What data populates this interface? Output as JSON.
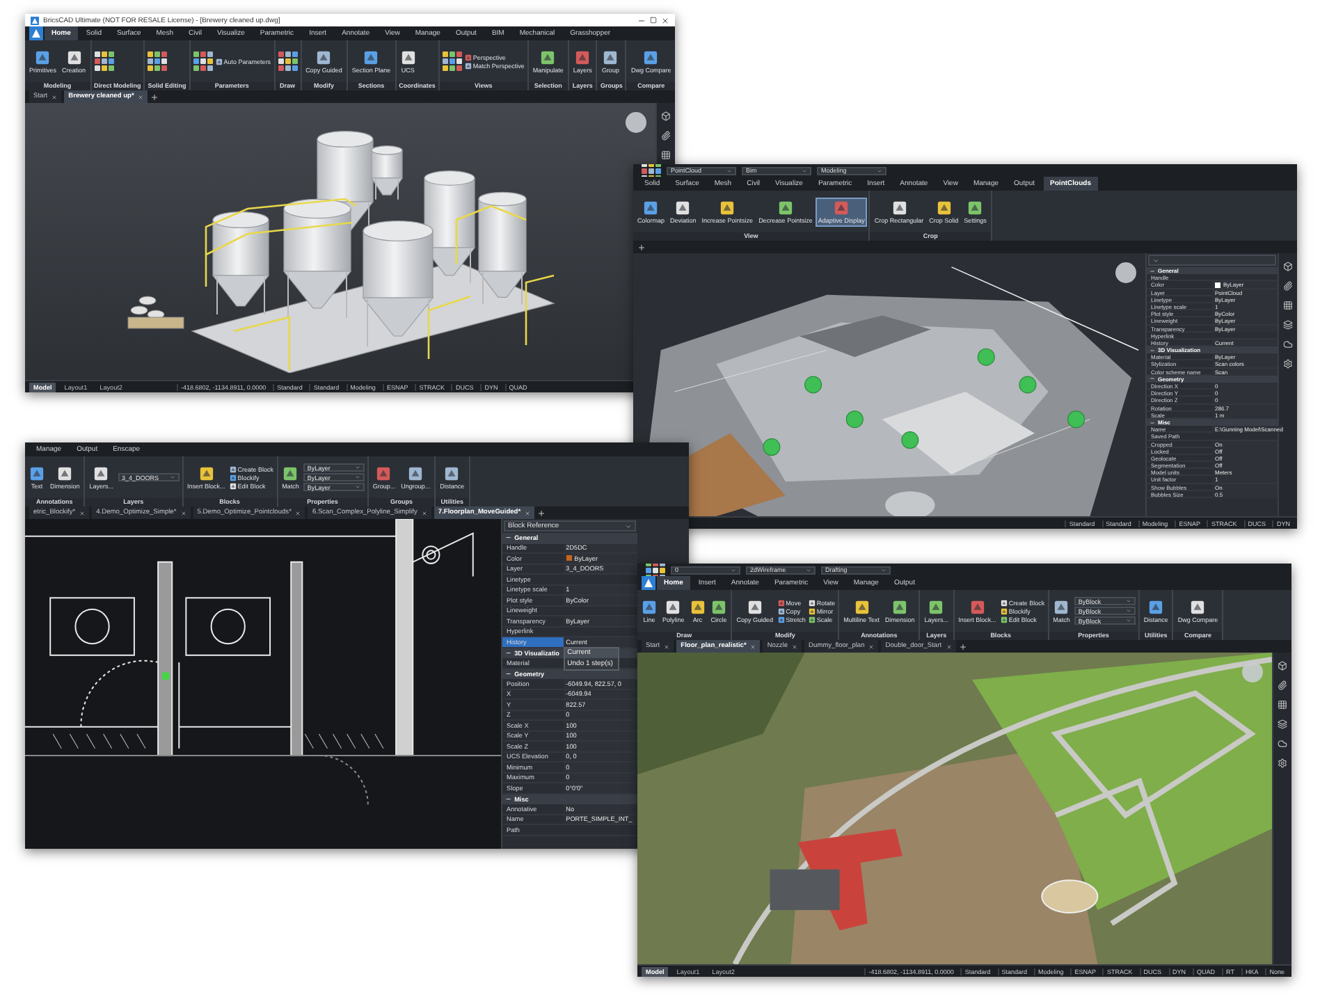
{
  "windows": [
    {
      "kind": "brewery",
      "title": "BricsCAD Ultimate (NOT FOR RESALE License) - [Brewery cleaned up.dwg]",
      "tabs": [
        {
          "label": "Home",
          "selected": true
        },
        {
          "label": "Solid",
          "selected": false
        },
        {
          "label": "Surface",
          "selected": false
        },
        {
          "label": "Mesh",
          "selected": false
        },
        {
          "label": "Civil",
          "selected": false
        },
        {
          "label": "Visualize",
          "selected": false
        },
        {
          "label": "Parametric",
          "selected": false
        },
        {
          "label": "Insert",
          "selected": false
        },
        {
          "label": "Annotate",
          "selected": false
        },
        {
          "label": "View",
          "selected": false
        },
        {
          "label": "Manage",
          "selected": false
        },
        {
          "label": "Output",
          "selected": false
        },
        {
          "label": "BIM",
          "selected": false
        },
        {
          "label": "Mechanical",
          "selected": false
        },
        {
          "label": "Grasshopper",
          "selected": false
        }
      ],
      "ribbon_panels": [
        {
          "label": "Modeling",
          "tools": [
            {
              "kind": "large",
              "label": "Primitives"
            },
            {
              "kind": "large",
              "label": "Creation"
            }
          ]
        },
        {
          "label": "Direct Modeling"
        },
        {
          "label": "Solid Editing"
        },
        {
          "label": "Parameters",
          "tools": [
            {
              "kind": "small",
              "label": "Auto Parameters"
            }
          ]
        },
        {
          "label": "Draw"
        },
        {
          "label": "Modify",
          "tools": [
            {
              "kind": "large",
              "label": "Copy Guided"
            }
          ]
        },
        {
          "label": "Sections",
          "tools": [
            {
              "kind": "large",
              "label": "Section Plane"
            }
          ]
        },
        {
          "label": "Coordinates",
          "tools": [
            {
              "kind": "large",
              "label": "UCS"
            }
          ]
        },
        {
          "label": "Views",
          "tools": [
            {
              "kind": "small",
              "label": "Perspective"
            },
            {
              "kind": "small",
              "label": "Match Perspective"
            }
          ]
        },
        {
          "label": "Selection",
          "tools": [
            {
              "kind": "large",
              "label": "Manipulate"
            }
          ]
        },
        {
          "label": "Layers",
          "tools": [
            {
              "kind": "large",
              "label": "Layers"
            }
          ]
        },
        {
          "label": "Groups",
          "tools": [
            {
              "kind": "large",
              "label": "Group"
            }
          ]
        },
        {
          "label": "Compare",
          "tools": [
            {
              "kind": "large",
              "label": "Dwg Compare"
            }
          ]
        }
      ],
      "doc_tabs": [
        {
          "label": "Start",
          "selected": false
        },
        {
          "label": "Brewery cleaned up*",
          "selected": true
        }
      ],
      "layout_tabs": [
        {
          "label": "Model",
          "selected": true
        },
        {
          "label": "Layout1",
          "selected": false
        },
        {
          "label": "Layout2",
          "selected": false
        }
      ],
      "status_items": [
        "-418.6802, -1134.8911, 0.0000",
        "Standard",
        "Standard",
        "Modeling",
        "ESNAP",
        "STRACK",
        "DUCS",
        "DYN",
        "QUAD"
      ]
    },
    {
      "kind": "pointcloud",
      "quick_fields": [
        "PointCloud",
        "Bim",
        "Modeling"
      ],
      "tabs": [
        {
          "label": "Solid",
          "selected": false
        },
        {
          "label": "Surface",
          "selected": false
        },
        {
          "label": "Mesh",
          "selected": false
        },
        {
          "label": "Civil",
          "selected": false
        },
        {
          "label": "Visualize",
          "selected": false
        },
        {
          "label": "Parametric",
          "selected": false
        },
        {
          "label": "Insert",
          "selected": false
        },
        {
          "label": "Annotate",
          "selected": false
        },
        {
          "label": "View",
          "selected": false
        },
        {
          "label": "Manage",
          "selected": false
        },
        {
          "label": "Output",
          "selected": false
        },
        {
          "label": "PointClouds",
          "selected": true
        }
      ],
      "ribbon_panels": [
        {
          "label": "View",
          "tools": [
            {
              "kind": "large",
              "label": "Colormap",
              "selected": false
            },
            {
              "kind": "large",
              "label": "Deviation",
              "selected": false
            },
            {
              "kind": "large",
              "label": "Increase Pointsize",
              "selected": false
            },
            {
              "kind": "large",
              "label": "Decrease Pointsize",
              "selected": false
            },
            {
              "kind": "large",
              "label": "Adaptive Display",
              "selected": true
            }
          ]
        },
        {
          "label": "Crop",
          "tools": [
            {
              "kind": "large",
              "label": "Crop Rectangular",
              "selected": false
            },
            {
              "kind": "large",
              "label": "Crop Solid",
              "selected": false
            },
            {
              "kind": "large",
              "label": "Settings",
              "selected": false
            }
          ]
        }
      ],
      "status_items": [
        "Standard",
        "Standard",
        "Modeling",
        "ESNAP",
        "STRACK",
        "DUCS",
        "DYN"
      ],
      "properties": {
        "sections": [
          {
            "title": "General",
            "rows": [
              {
                "label": "Handle",
                "selected": false
              },
              {
                "label": "Color",
                "value": "ByLayer",
                "color": "#ffffff",
                "selected": false
              },
              {
                "label": "Layer",
                "value": "PointCloud",
                "selected": false
              },
              {
                "label": "Linetype",
                "value": "ByLayer",
                "selected": false
              },
              {
                "label": "Linetype scale",
                "value": "1",
                "selected": false
              },
              {
                "label": "Plot style",
                "value": "ByColor",
                "selected": false
              },
              {
                "label": "Lineweight",
                "value": "ByLayer",
                "selected": false
              },
              {
                "label": "Transparency",
                "value": "ByLayer",
                "selected": false
              },
              {
                "label": "Hyperlink",
                "selected": false
              },
              {
                "label": "History",
                "value": "Current",
                "selected": false
              }
            ]
          },
          {
            "title": "3D Visualization",
            "rows": [
              {
                "label": "Material",
                "value": "ByLayer",
                "selected": false
              },
              {
                "label": "Stylization",
                "value": "Scan colors",
                "selected": false
              },
              {
                "label": "Color scheme name",
                "value": "Scan",
                "selected": false
              }
            ]
          },
          {
            "title": "Geometry",
            "rows": [
              {
                "label": "Direction X",
                "value": "0",
                "selected": false
              },
              {
                "label": "Direction Y",
                "value": "0",
                "selected": false
              },
              {
                "label": "Direction Z",
                "value": "0",
                "selected": false
              },
              {
                "label": "Rotation",
                "value": "286.7",
                "selected": false
              },
              {
                "label": "Scale",
                "value": "1 m",
                "selected": false
              }
            ]
          },
          {
            "title": "Misc",
            "rows": [
              {
                "label": "Name",
                "value": "E:\\Gunning Model\\Scanned",
                "selected": false
              },
              {
                "label": "Saved Path",
                "selected": false
              },
              {
                "label": "Cropped",
                "value": "On",
                "selected": false
              },
              {
                "label": "Locked",
                "value": "Off",
                "selected": false
              },
              {
                "label": "Geolocate",
                "value": "Off",
                "selected": false
              },
              {
                "label": "Segmentation",
                "value": "Off",
                "selected": false
              },
              {
                "label": "Model units",
                "value": "Meters",
                "selected": false
              },
              {
                "label": "Unit factor",
                "value": "1",
                "selected": false
              },
              {
                "label": "Show Bubbles",
                "value": "On",
                "selected": false
              },
              {
                "label": "Bubbles Size",
                "value": "0.5",
                "selected": false
              }
            ]
          }
        ]
      }
    },
    {
      "kind": "floorplan",
      "tabs": [
        {
          "label": "Manage",
          "selected": false
        },
        {
          "label": "Output",
          "selected": false
        },
        {
          "label": "Enscape",
          "selected": false
        }
      ],
      "ribbon_panels": [
        {
          "label": "Annotations",
          "tools": [
            {
              "kind": "large",
              "label": "Text"
            },
            {
              "kind": "large",
              "label": "Dimension"
            }
          ]
        },
        {
          "label": "Layers",
          "tools": [
            {
              "kind": "large",
              "label": "Layers..."
            },
            {
              "kind": "field",
              "label": "3_4_DOORS"
            }
          ]
        },
        {
          "label": "Blocks",
          "tools": [
            {
              "kind": "large",
              "label": "Insert Block..."
            },
            {
              "kind": "small",
              "label": "Create Block"
            },
            {
              "kind": "small",
              "label": "Blockify"
            },
            {
              "kind": "small",
              "label": "Edit Block"
            }
          ]
        },
        {
          "label": "Properties",
          "tools": [
            {
              "kind": "large",
              "label": "Match"
            },
            {
              "kind": "field",
              "label": "ByLayer"
            },
            {
              "kind": "field",
              "label": "ByLayer"
            },
            {
              "kind": "field",
              "label": "ByLayer"
            }
          ]
        },
        {
          "label": "Groups",
          "tools": [
            {
              "kind": "large",
              "label": "Group..."
            },
            {
              "kind": "large",
              "label": "Ungroup..."
            }
          ]
        },
        {
          "label": "Utilities",
          "tools": [
            {
              "kind": "large",
              "label": "Distance"
            }
          ]
        }
      ],
      "doc_tabs": [
        {
          "label": "etric_Blockify*",
          "selected": false
        },
        {
          "label": "4.Demo_Optimize_Simple*",
          "selected": false
        },
        {
          "label": "5.Demo_Optimize_Pointclouds*",
          "selected": false
        },
        {
          "label": "6.Scan_Complex_Polyline_Simplify",
          "selected": false
        },
        {
          "label": "7.Floorplan_MoveGuided*",
          "selected": true
        }
      ],
      "properties": {
        "header": "Block Reference",
        "sections": [
          {
            "title": "General",
            "rows": [
              {
                "label": "Handle",
                "value": "2D5DC",
                "selected": false
              },
              {
                "label": "Color",
                "value": "ByLayer",
                "color": "#c8641e",
                "selected": false
              },
              {
                "label": "Layer",
                "value": "3_4_DOORS",
                "selected": false
              },
              {
                "label": "Linetype",
                "selected": false
              },
              {
                "label": "Linetype scale",
                "value": "1",
                "selected": false
              },
              {
                "label": "Plot style",
                "value": "ByColor",
                "selected": false
              },
              {
                "label": "Lineweight",
                "selected": false
              },
              {
                "label": "Transparency",
                "value": "ByLayer",
                "selected": false
              },
              {
                "label": "Hyperlink",
                "selected": false
              },
              {
                "label": "History",
                "value": "Current",
                "selected": true
              }
            ]
          },
          {
            "title": "3D Visualizatio",
            "rows": [
              {
                "label": "Material",
                "selected": false
              }
            ]
          },
          {
            "title": "Geometry",
            "rows": [
              {
                "label": "Position",
                "value": "-6049.94, 822.57, 0",
                "selected": false
              },
              {
                "label": "X",
                "value": "-6049.94",
                "selected": false
              },
              {
                "label": "Y",
                "value": "822.57",
                "selected": false
              },
              {
                "label": "Z",
                "value": "0",
                "selected": false
              },
              {
                "label": "Scale X",
                "value": "100",
                "selected": false
              },
              {
                "label": "Scale Y",
                "value": "100",
                "selected": false
              },
              {
                "label": "Scale Z",
                "value": "100",
                "selected": false
              },
              {
                "label": "UCS Elevation",
                "value": "0, 0",
                "selected": false
              },
              {
                "label": "Minimum",
                "value": "0",
                "selected": false
              },
              {
                "label": "Maximum",
                "value": "0",
                "selected": false
              },
              {
                "label": "Slope",
                "value": "0°0'0\"",
                "selected": false
              }
            ]
          },
          {
            "title": "Misc",
            "rows": [
              {
                "label": "Annotative",
                "value": "No",
                "selected": false
              },
              {
                "label": "Name",
                "value": "PORTE_SIMPLE_INT_",
                "selected": false
              },
              {
                "label": "Path",
                "selected": false
              }
            ]
          }
        ],
        "dropdown": [
          {
            "label": "Current",
            "selected": true
          },
          {
            "label": "Undo 1 step(s)",
            "selected": false
          }
        ]
      }
    },
    {
      "kind": "aerial",
      "quick_fields": [
        "0",
        "2dWireframe",
        "Drafting"
      ],
      "tabs": [
        {
          "label": "Home",
          "selected": true
        },
        {
          "label": "Insert",
          "selected": false
        },
        {
          "label": "Annotate",
          "selected": false
        },
        {
          "label": "Parametric",
          "selected": false
        },
        {
          "label": "View",
          "selected": false
        },
        {
          "label": "Manage",
          "selected": false
        },
        {
          "label": "Output",
          "selected": false
        }
      ],
      "ribbon_panels": [
        {
          "label": "Draw",
          "tools": [
            {
              "kind": "large",
              "label": "Line"
            },
            {
              "kind": "large",
              "label": "Polyline"
            },
            {
              "kind": "large",
              "label": "Arc"
            },
            {
              "kind": "large",
              "label": "Circle"
            }
          ]
        },
        {
          "label": "Modify",
          "tools": [
            {
              "kind": "large",
              "label": "Copy Guided"
            },
            {
              "kind": "small",
              "label": "Move"
            },
            {
              "kind": "small",
              "label": "Copy"
            },
            {
              "kind": "small",
              "label": "Stretch"
            },
            {
              "kind": "small",
              "label": "Rotate"
            },
            {
              "kind": "small",
              "label": "Mirror"
            },
            {
              "kind": "small",
              "label": "Scale"
            }
          ]
        },
        {
          "label": "Annotations",
          "tools": [
            {
              "kind": "large",
              "label": "Multiline Text"
            },
            {
              "kind": "large",
              "label": "Dimension"
            }
          ]
        },
        {
          "label": "Layers",
          "tools": [
            {
              "kind": "large",
              "label": "Layers..."
            }
          ]
        },
        {
          "label": "Blocks",
          "tools": [
            {
              "kind": "large",
              "label": "Insert Block..."
            },
            {
              "kind": "small",
              "label": "Create Block"
            },
            {
              "kind": "small",
              "label": "Blockify"
            },
            {
              "kind": "small",
              "label": "Edit Block"
            }
          ]
        },
        {
          "label": "Properties",
          "tools": [
            {
              "kind": "large",
              "label": "Match"
            },
            {
              "kind": "field",
              "label": "ByBlock"
            },
            {
              "kind": "field",
              "label": "ByBlock"
            },
            {
              "kind": "field",
              "label": "ByBlock"
            }
          ]
        },
        {
          "label": "Utilities",
          "tools": [
            {
              "kind": "large",
              "label": "Distance"
            }
          ]
        },
        {
          "label": "Compare",
          "tools": [
            {
              "kind": "large",
              "label": "Dwg Compare"
            }
          ]
        }
      ],
      "doc_tabs": [
        {
          "label": "Start",
          "selected": false
        },
        {
          "label": "Floor_plan_realistic*",
          "selected": true
        },
        {
          "label": "Nozzle",
          "selected": false
        },
        {
          "label": "Dummy_floor_plan",
          "selected": false
        },
        {
          "label": "Double_door_Start",
          "selected": false
        }
      ],
      "layout_tabs": [
        {
          "label": "Model",
          "selected": true
        },
        {
          "label": "Layout1",
          "selected": false
        },
        {
          "label": "Layout2",
          "selected": false
        }
      ],
      "status_items": [
        "-418.6802, -1134.8911, 0.0000",
        "Standard",
        "Standard",
        "Modeling",
        "ESNAP",
        "STRACK",
        "DUCS",
        "DYN",
        "QUAD",
        "RT",
        "HKA",
        "None"
      ]
    }
  ]
}
